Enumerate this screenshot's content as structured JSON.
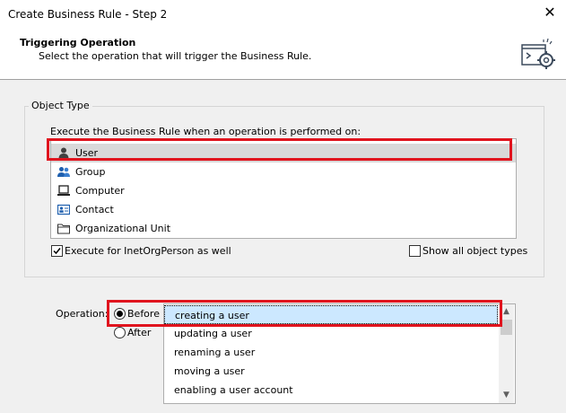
{
  "window": {
    "title": "Create Business Rule - Step 2",
    "close_glyph": "✕"
  },
  "header": {
    "title": "Triggering Operation",
    "subtitle": "Select the operation that will trigger the Business Rule.",
    "icon": "console-gear-icon"
  },
  "object_type": {
    "legend": "Object Type",
    "label": "Execute the Business Rule when an operation is performed on:",
    "items": [
      {
        "label": "User",
        "icon": "user-icon",
        "selected": true
      },
      {
        "label": "Group",
        "icon": "group-icon",
        "selected": false
      },
      {
        "label": "Computer",
        "icon": "computer-icon",
        "selected": false
      },
      {
        "label": "Contact",
        "icon": "contact-card-icon",
        "selected": false
      },
      {
        "label": "Organizational Unit",
        "icon": "folder-icon",
        "selected": false
      }
    ],
    "inetorg_checkbox": {
      "label": "Execute for InetOrgPerson as well",
      "checked": true
    },
    "show_all_checkbox": {
      "label": "Show all object types",
      "checked": false
    }
  },
  "operation": {
    "label": "Operation:",
    "before": {
      "label": "Before",
      "selected": true
    },
    "after": {
      "label": "After",
      "selected": false
    },
    "items": [
      {
        "label": "creating a user",
        "selected": true
      },
      {
        "label": "updating a user",
        "selected": false
      },
      {
        "label": "renaming a user",
        "selected": false
      },
      {
        "label": "moving a user",
        "selected": false
      },
      {
        "label": "enabling a user account",
        "selected": false
      }
    ]
  },
  "colors": {
    "highlight_red": "#e0141e",
    "selection_blue": "#cce8ff",
    "selection_gray": "#d9d9d9"
  }
}
